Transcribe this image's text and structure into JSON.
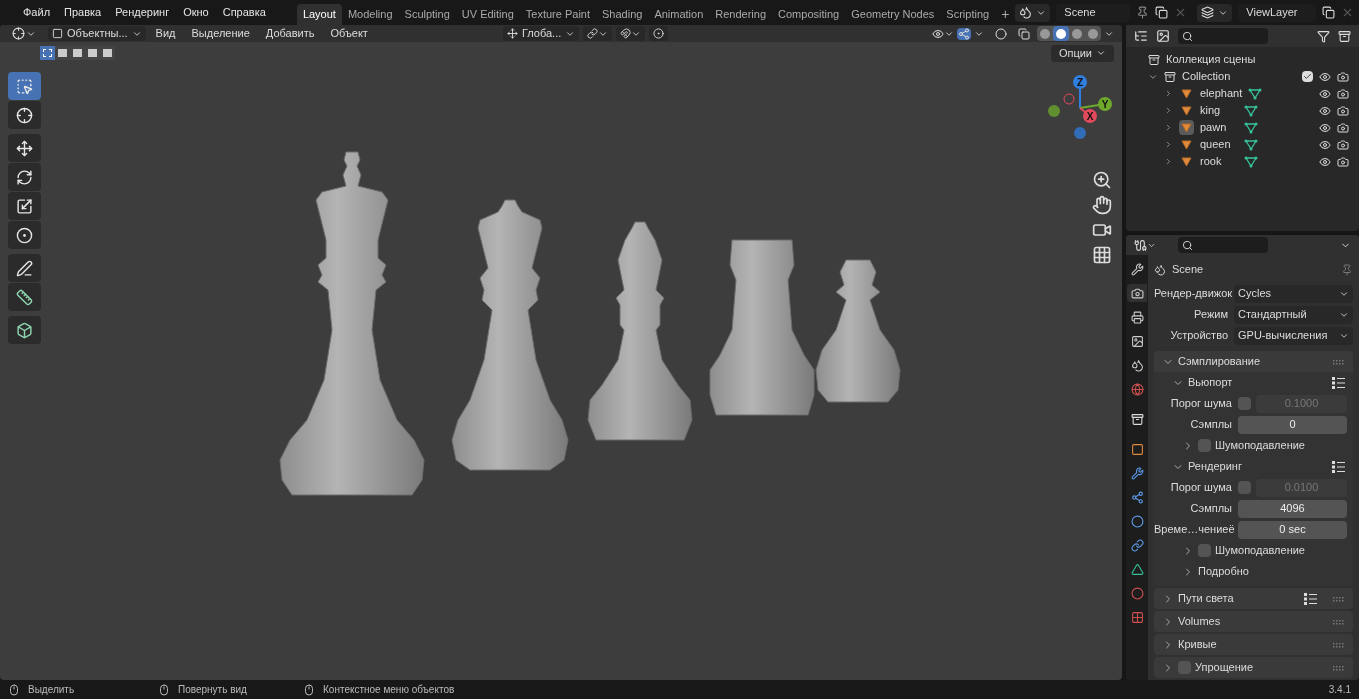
{
  "top_menu": [
    "Файл",
    "Правка",
    "Рендеринг",
    "Окно",
    "Справка"
  ],
  "workspaces": [
    {
      "label": "Layout",
      "selected": true
    },
    {
      "label": "Modeling",
      "selected": false
    },
    {
      "label": "Sculpting",
      "selected": false
    },
    {
      "label": "UV Editing",
      "selected": false
    },
    {
      "label": "Texture Paint",
      "selected": false
    },
    {
      "label": "Shading",
      "selected": false
    },
    {
      "label": "Animation",
      "selected": false
    },
    {
      "label": "Rendering",
      "selected": false
    },
    {
      "label": "Compositing",
      "selected": false
    },
    {
      "label": "Geometry Nodes",
      "selected": false
    },
    {
      "label": "Scripting",
      "selected": false
    }
  ],
  "add_workspace": "+",
  "scene": {
    "value": "Scene"
  },
  "view_layer": {
    "value": "ViewLayer"
  },
  "viewport": {
    "mode": "Объектны...",
    "menus": [
      "Вид",
      "Выделение",
      "Добавить",
      "Объект"
    ],
    "orientation": "Глоба...",
    "options": "Опции",
    "select_modes": [
      {
        "selected": true
      },
      {
        "selected": false
      },
      {
        "selected": false
      },
      {
        "selected": false
      },
      {
        "selected": false
      }
    ],
    "shading_modes": [
      {
        "selected": false
      },
      {
        "selected": true
      },
      {
        "selected": false
      },
      {
        "selected": false
      }
    ],
    "tools": [
      {
        "selected": true
      },
      {
        "selected": false
      },
      {
        "selected": false
      },
      {
        "selected": false
      },
      {
        "selected": false
      },
      {
        "selected": false
      },
      {
        "selected": false
      },
      {
        "selected": false
      },
      {
        "selected": false
      }
    ],
    "gizmo_axes": [
      {
        "label": "Z",
        "color": "#2f7fe0"
      },
      {
        "label": "Y",
        "color": "#6ea92b"
      },
      {
        "label": "X",
        "color": "#e04a5a"
      }
    ]
  },
  "outliner": {
    "root": "Коллекция сцены",
    "collection": {
      "label": "Collection",
      "expanded": true,
      "checked": true,
      "children": [
        {
          "label": "elephant",
          "active": false
        },
        {
          "label": "king",
          "active": false
        },
        {
          "label": "pawn",
          "active": true
        },
        {
          "label": "queen",
          "active": false
        },
        {
          "label": "rook",
          "active": false
        }
      ]
    }
  },
  "properties": {
    "tabs": [
      {
        "selected": false
      },
      {
        "selected": true
      },
      {
        "selected": false
      },
      {
        "selected": false
      },
      {
        "selected": false
      },
      {
        "selected": false
      },
      {
        "selected": false
      },
      {
        "selected": false
      },
      {
        "selected": false
      },
      {
        "selected": false
      },
      {
        "selected": false
      },
      {
        "selected": false
      },
      {
        "selected": false
      },
      {
        "selected": false
      },
      {
        "selected": false
      }
    ],
    "context": "Scene",
    "fields": [
      {
        "label": "Рендер-движок",
        "value": "Cycles"
      },
      {
        "label": "Режим",
        "value": "Стандартный"
      },
      {
        "label": "Устройство",
        "value": "GPU-вычисления"
      }
    ],
    "panels": [
      {
        "kind": "panel",
        "label": "Сэмплирование",
        "expanded": true,
        "children": [
          {
            "kind": "panel",
            "label": "Вьюпорт",
            "expanded": true,
            "presets": true,
            "children": [
              {
                "kind": "toggle_number",
                "label": "Порог шума",
                "checked": false,
                "value": "0.1000"
              },
              {
                "kind": "number",
                "label": "Сэмплы",
                "value": "0"
              },
              {
                "kind": "panel",
                "label": "Шумоподавление",
                "expanded": false,
                "checked": false
              }
            ]
          },
          {
            "kind": "panel",
            "label": "Рендеринг",
            "expanded": true,
            "presets": true,
            "children": [
              {
                "kind": "toggle_number",
                "label": "Порог шума",
                "checked": false,
                "value": "0.0100"
              },
              {
                "kind": "number",
                "label": "Сэмплы",
                "value": "4096"
              },
              {
                "kind": "number",
                "label": "Време…чениеё",
                "value": "0 sec"
              },
              {
                "kind": "panel",
                "label": "Шумоподавление",
                "expanded": false,
                "checked": false
              },
              {
                "kind": "panel",
                "label": "Подробно",
                "expanded": false
              }
            ]
          }
        ]
      },
      {
        "kind": "panel",
        "label": "Пути света",
        "expanded": false,
        "presets": true
      },
      {
        "kind": "panel",
        "label": "Volumes",
        "expanded": false
      },
      {
        "kind": "panel",
        "label": "Кривые",
        "expanded": false
      },
      {
        "kind": "panel",
        "label": "Упрощение",
        "expanded": false,
        "checked": false
      }
    ]
  },
  "status_bar": {
    "hints": [
      "Выделить",
      "Повернуть вид",
      "Контекстное меню объектов"
    ],
    "version": "3.4.1"
  }
}
